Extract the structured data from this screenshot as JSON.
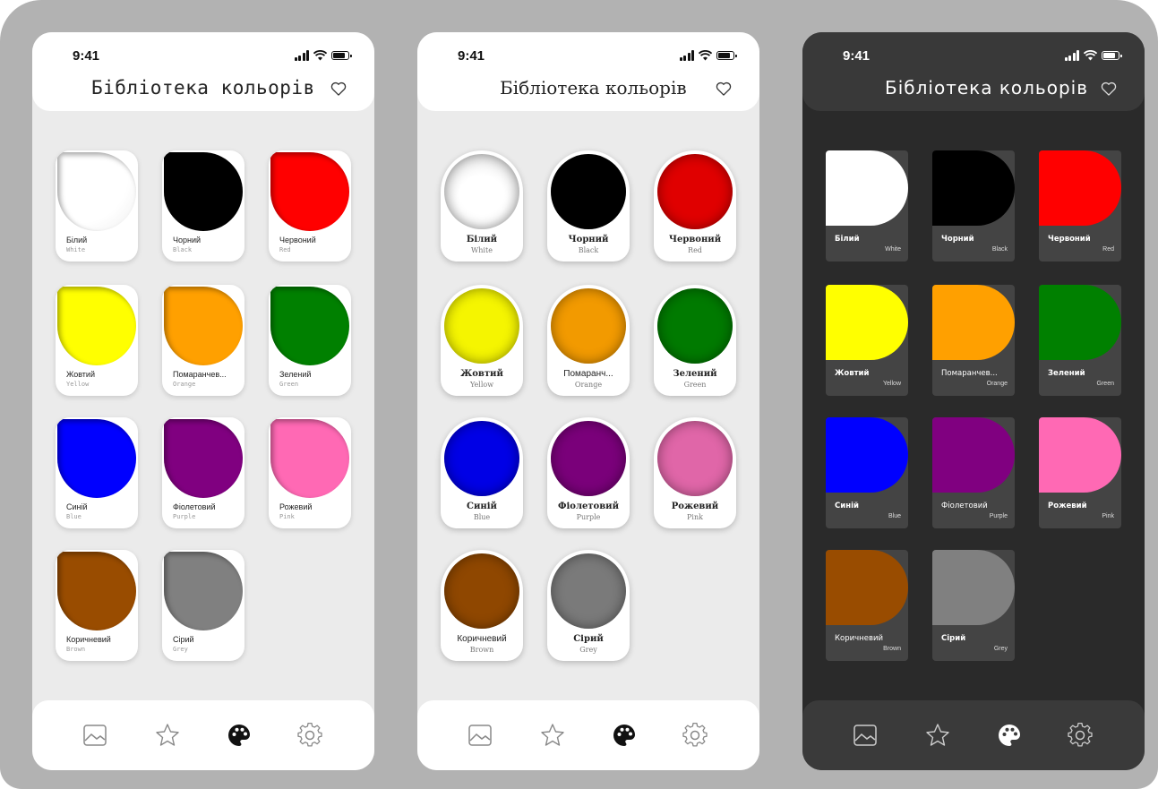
{
  "screens": [
    {
      "time": "9:41",
      "title": "Бібліотека кольорів"
    },
    {
      "time": "9:41",
      "title": "Бібліотека кольорів"
    },
    {
      "time": "9:41",
      "title": "Бібліотека кольорів"
    }
  ],
  "colors": [
    {
      "name": "Білий",
      "en": "White",
      "hex": "#ffffff"
    },
    {
      "name": "Чорний",
      "en": "Black",
      "hex": "#000000"
    },
    {
      "name": "Червоний",
      "en": "Red",
      "hex": "#ff0000"
    },
    {
      "name": "Жовтий",
      "en": "Yellow",
      "hex": "#ffff00"
    },
    {
      "name": "Помаранчев...",
      "en": "Orange",
      "hex": "#ffa500"
    },
    {
      "name": "Зелений",
      "en": "Green",
      "hex": "#008000"
    },
    {
      "name": "Синій",
      "en": "Blue",
      "hex": "#0000ff"
    },
    {
      "name": "Фіолетовий",
      "en": "Purple",
      "hex": "#800080"
    },
    {
      "name": "Рожевий",
      "en": "Pink",
      "hex": "#ff69b4"
    },
    {
      "name": "Коричневий",
      "en": "Brown",
      "hex": "#994c00"
    },
    {
      "name": "Сірий",
      "en": "Grey",
      "hex": "#808080"
    }
  ],
  "color_names_screen2": {
    "orange": "Помаранч..."
  },
  "tabs": [
    {
      "icon": "image-icon"
    },
    {
      "icon": "star-icon"
    },
    {
      "icon": "palette-icon",
      "active": true
    },
    {
      "icon": "settings-icon"
    }
  ]
}
